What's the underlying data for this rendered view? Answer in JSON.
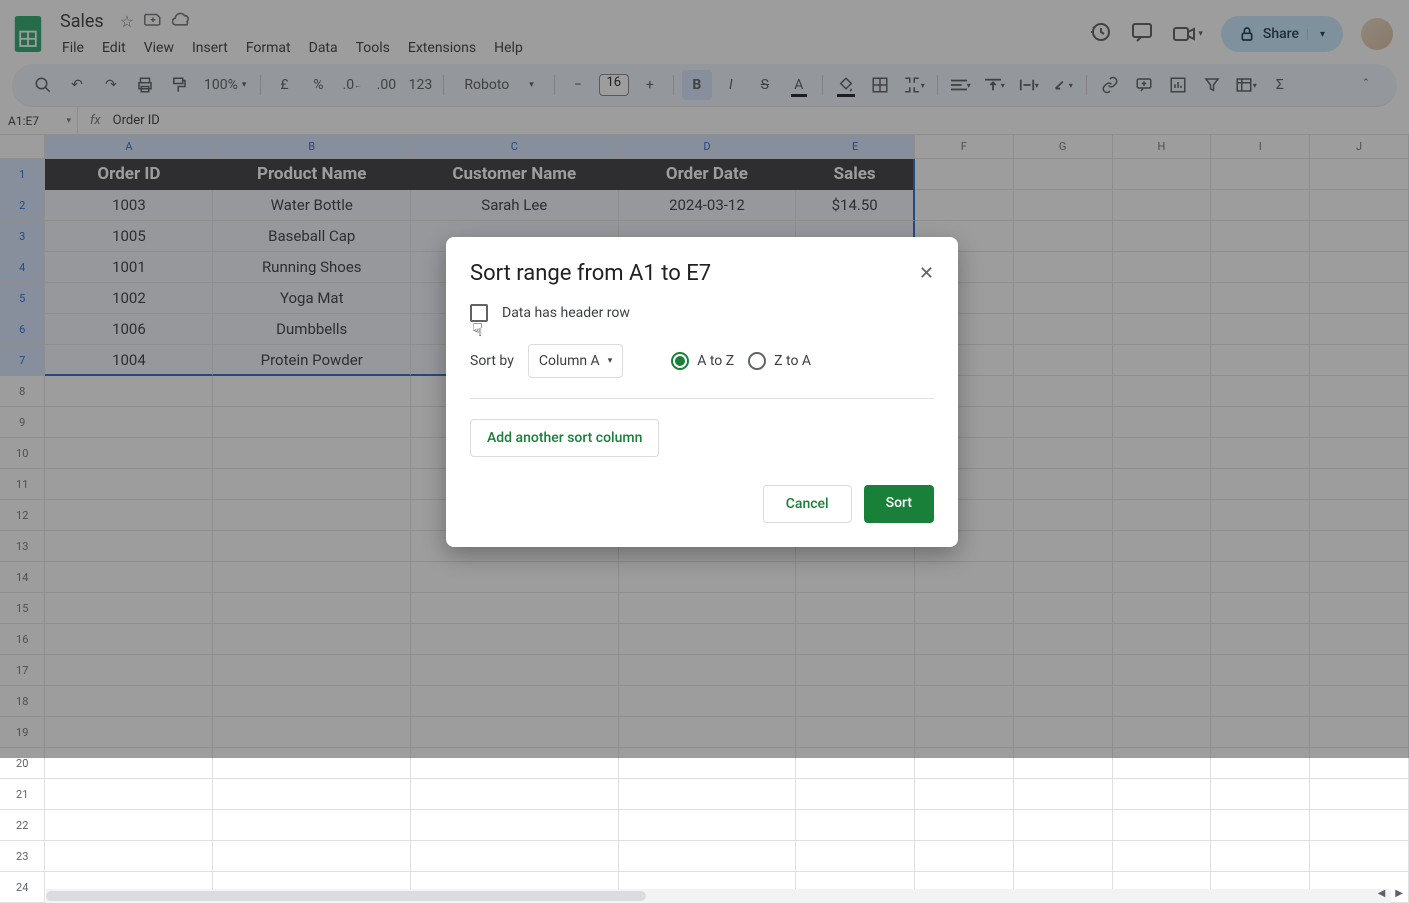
{
  "doc": {
    "title": "Sales"
  },
  "menus": [
    "File",
    "Edit",
    "View",
    "Insert",
    "Format",
    "Data",
    "Tools",
    "Extensions",
    "Help"
  ],
  "share": {
    "label": "Share"
  },
  "toolbar": {
    "zoom": "100%",
    "font": "Roboto",
    "font_size": "16"
  },
  "namebox": {
    "ref": "A1:E7",
    "fx_value": "Order ID"
  },
  "columns": [
    "A",
    "B",
    "C",
    "D",
    "E",
    "F",
    "G",
    "H",
    "I",
    "J"
  ],
  "col_widths": [
    "colA",
    "colB",
    "colC",
    "colD",
    "colE",
    "colRest",
    "colRest",
    "colRest",
    "colRest",
    "colRest"
  ],
  "sel_cols": 5,
  "sel_rows": 7,
  "headers": [
    "Order ID",
    "Product Name",
    "Customer Name",
    "Order Date",
    "Sales"
  ],
  "rows": [
    [
      "1003",
      "Water Bottle",
      "Sarah Lee",
      "2024-03-12",
      "$14.50"
    ],
    [
      "1005",
      "Baseball Cap",
      "",
      "",
      ""
    ],
    [
      "1001",
      "Running Shoes",
      "",
      "",
      ""
    ],
    [
      "1002",
      "Yoga Mat",
      "",
      "",
      ""
    ],
    [
      "1006",
      "Dumbbells",
      "",
      "",
      ""
    ],
    [
      "1004",
      "Protein Powder",
      "",
      "",
      ""
    ]
  ],
  "empty_rows": 17,
  "dialog": {
    "title": "Sort range from A1 to E7",
    "header_checkbox_label": "Data has header row",
    "sort_by_label": "Sort by",
    "sort_by_value": "Column A",
    "radio_a": "A to Z",
    "radio_z": "Z to A",
    "radio_selected": "a",
    "add_column": "Add another sort column",
    "cancel": "Cancel",
    "sort": "Sort"
  }
}
